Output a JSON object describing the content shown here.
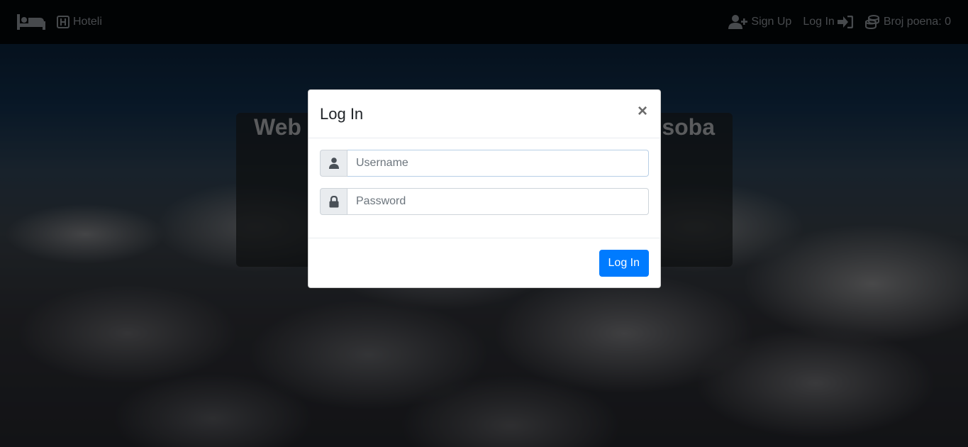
{
  "navbar": {
    "brand_icon": "bed-icon",
    "brand_label": "Hoteli",
    "brand_label_icon": "hotel-h-icon",
    "signup_label": "Sign Up",
    "signup_icon": "user-plus-icon",
    "login_label": "Log In",
    "login_icon": "sign-in-icon",
    "points_label": "Broj poena: 0",
    "points_icon": "coins-icon",
    "text_color": "#6e7277"
  },
  "jumbotron": {
    "title_left": "Web",
    "title_right": "soba"
  },
  "modal": {
    "title": "Log In",
    "close_label": "×",
    "username": {
      "icon": "user-icon",
      "placeholder": "Username",
      "value": ""
    },
    "password": {
      "icon": "lock-icon",
      "placeholder": "Password",
      "value": ""
    },
    "submit_label": "Log In",
    "accent_color": "#007bff"
  }
}
